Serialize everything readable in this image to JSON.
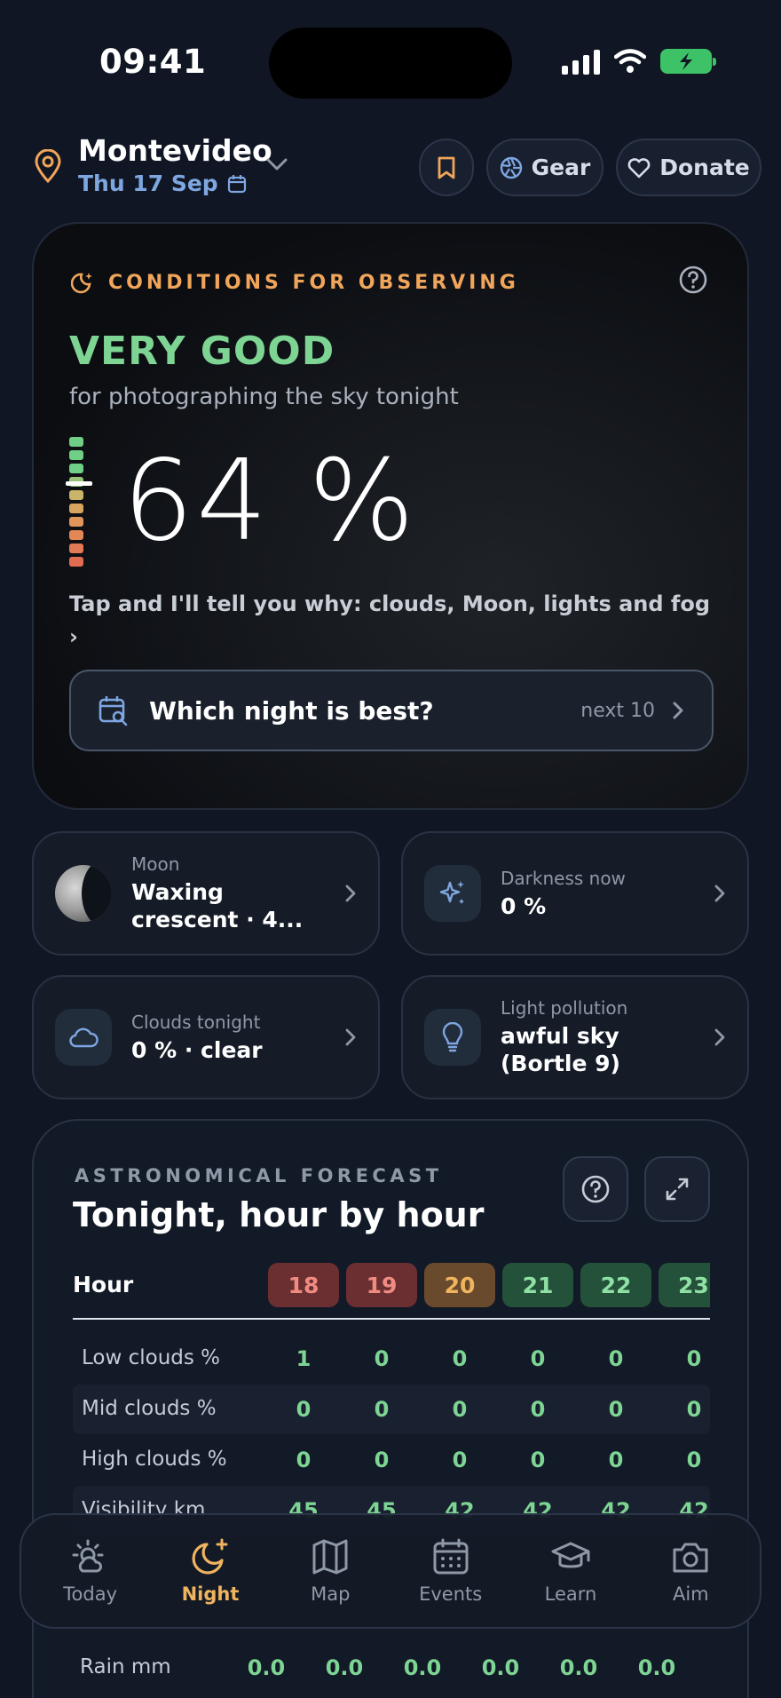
{
  "status": {
    "time": "09:41"
  },
  "header": {
    "city": "Montevideo",
    "date": "Thu 17 Sep",
    "buttons": {
      "gear": "Gear",
      "donate": "Donate"
    }
  },
  "conditions": {
    "eyebrow": "CONDITIONS FOR OBSERVING",
    "rating": "VERY GOOD",
    "subtitle": "for photographing the sky tonight",
    "percent": "64 %",
    "score": 0.64,
    "tap_hint": "Tap and I'll tell you why: clouds, Moon, lights and fog ›",
    "best_night": {
      "label": "Which night is best?",
      "next": "next 10"
    },
    "colors": {
      "rating": "#7dd493",
      "accent": "#f0a55a"
    }
  },
  "tiles": [
    {
      "label": "Moon",
      "value": "Waxing crescent · 4...",
      "icon": "moon-phase-icon"
    },
    {
      "label": "Darkness now",
      "value": "0 %",
      "icon": "sparkles-icon"
    },
    {
      "label": "Clouds tonight",
      "value": "0 % · clear",
      "icon": "cloud-icon"
    },
    {
      "label": "Light pollution",
      "value": "awful sky (Bortle 9)",
      "icon": "lightbulb-icon"
    }
  ],
  "forecast": {
    "eyebrow": "ASTRONOMICAL FORECAST",
    "title": "Tonight, hour by hour",
    "hour_label": "Hour",
    "hours": [
      {
        "h": "18",
        "bg": "#6b2f31",
        "fg": "#f08b82"
      },
      {
        "h": "19",
        "bg": "#6b2f31",
        "fg": "#f08b82"
      },
      {
        "h": "20",
        "bg": "#6a4a2c",
        "fg": "#f0b35e"
      },
      {
        "h": "21",
        "bg": "#24513a",
        "fg": "#8fe0a5"
      },
      {
        "h": "22",
        "bg": "#24513a",
        "fg": "#8fe0a5"
      },
      {
        "h": "23",
        "bg": "#24513a",
        "fg": "#8fe0a5"
      }
    ],
    "rows": [
      {
        "label": "Low clouds %",
        "values": [
          "1",
          "0",
          "0",
          "0",
          "0",
          "0"
        ]
      },
      {
        "label": "Mid clouds %",
        "values": [
          "0",
          "0",
          "0",
          "0",
          "0",
          "0"
        ]
      },
      {
        "label": "High clouds %",
        "values": [
          "0",
          "0",
          "0",
          "0",
          "0",
          "0"
        ]
      },
      {
        "label": "Visibility km",
        "values": [
          "45",
          "45",
          "42",
          "42",
          "42",
          "42"
        ]
      }
    ],
    "rain": {
      "label": "Rain mm",
      "values": [
        "0.0",
        "0.0",
        "0.0",
        "0.0",
        "0.0",
        "0.0"
      ]
    }
  },
  "nav": [
    {
      "label": "Today",
      "icon": "sun-cloud-icon",
      "active": false
    },
    {
      "label": "Night",
      "icon": "moon-sparkle-icon",
      "active": true
    },
    {
      "label": "Map",
      "icon": "map-icon",
      "active": false
    },
    {
      "label": "Events",
      "icon": "calendar-icon",
      "active": false
    },
    {
      "label": "Learn",
      "icon": "graduation-cap-icon",
      "active": false
    },
    {
      "label": "Aim",
      "icon": "camera-icon",
      "active": false
    }
  ]
}
